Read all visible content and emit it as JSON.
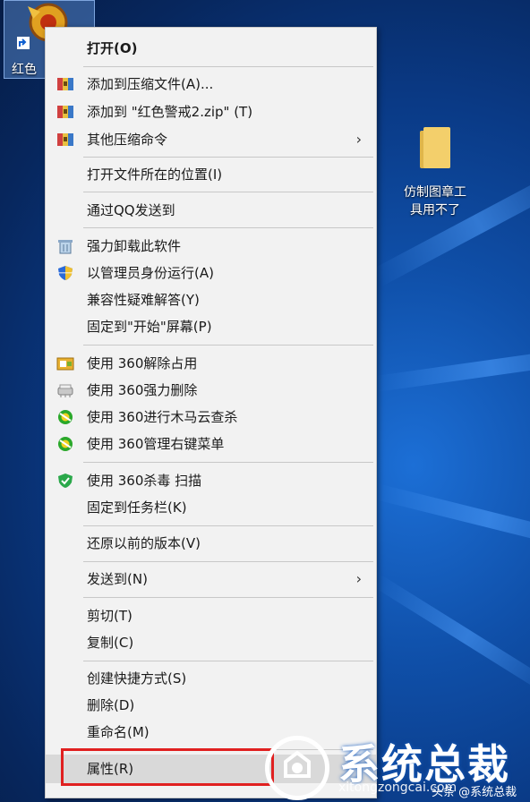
{
  "desktop": {
    "selected_icon_label": "红色",
    "folder_label_line1": "仿制图章工",
    "folder_label_line2": "具用不了"
  },
  "menu": {
    "items": [
      {
        "label": "打开(O)",
        "icon": "none"
      },
      {
        "label": "添加到压缩文件(A)...",
        "icon": "archive-icon"
      },
      {
        "label": "添加到 \"红色警戒2.zip\" (T)",
        "icon": "archive-icon"
      },
      {
        "label": "其他压缩命令",
        "icon": "archive-icon",
        "submenu_arrow": "›"
      },
      {
        "label": "打开文件所在的位置(I)",
        "icon": "none"
      },
      {
        "label": "通过QQ发送到",
        "icon": "none"
      },
      {
        "label": "强力卸载此软件",
        "icon": "trash-icon"
      },
      {
        "label": "以管理员身份运行(A)",
        "icon": "shield-icon"
      },
      {
        "label": "兼容性疑难解答(Y)",
        "icon": "none"
      },
      {
        "label": "固定到\"开始\"屏幕(P)",
        "icon": "none"
      },
      {
        "label": "使用 360解除占用",
        "icon": "unlock-icon"
      },
      {
        "label": "使用 360强力删除",
        "icon": "shredder-icon"
      },
      {
        "label": "使用 360进行木马云查杀",
        "icon": "360-icon"
      },
      {
        "label": "使用 360管理右键菜单",
        "icon": "360-icon"
      },
      {
        "label": "使用 360杀毒 扫描",
        "icon": "360-antivirus-icon"
      },
      {
        "label": "固定到任务栏(K)",
        "icon": "none"
      },
      {
        "label": "还原以前的版本(V)",
        "icon": "none"
      },
      {
        "label": "发送到(N)",
        "icon": "none",
        "submenu_arrow": "›"
      },
      {
        "label": "剪切(T)",
        "icon": "none"
      },
      {
        "label": "复制(C)",
        "icon": "none"
      },
      {
        "label": "创建快捷方式(S)",
        "icon": "none"
      },
      {
        "label": "删除(D)",
        "icon": "none"
      },
      {
        "label": "重命名(M)",
        "icon": "none"
      },
      {
        "label": "属性(R)",
        "icon": "none",
        "highlighted": true
      }
    ]
  },
  "watermark": {
    "title": "系统总裁",
    "url": "xitongzongcai.com",
    "source": "头条 @系统总裁"
  },
  "colors": {
    "highlight_box": "#e02020",
    "menu_bg": "#f2f2f2",
    "desktop_blue": "#0a3a86"
  }
}
